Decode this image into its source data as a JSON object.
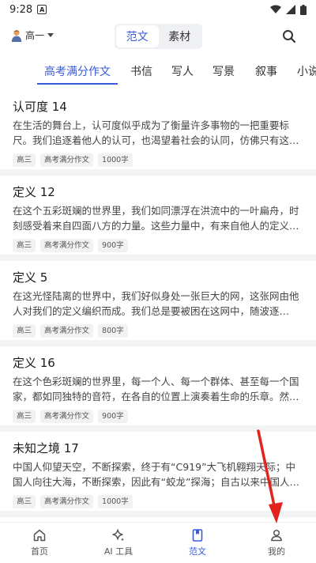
{
  "status_bar": {
    "time": "9:28",
    "app_letter": "A"
  },
  "header": {
    "grade_label": "高一",
    "segments": [
      "范文",
      "素材"
    ],
    "active_segment": 0
  },
  "categories": [
    "高考满分作文",
    "书信",
    "写人",
    "写景",
    "叙事",
    "小说"
  ],
  "active_category": 0,
  "articles": [
    {
      "title": "认可度 14",
      "excerpt": "在生活的舞台上，认可度似乎成为了衡量许多事物的一把重要标尺。我们追逐着他人的认可，也渴望着社会的认同，仿佛只有这…",
      "tags": [
        "高三",
        "高考满分作文",
        "1000字"
      ]
    },
    {
      "title": "定义 12",
      "excerpt": "在这个五彩斑斓的世界里，我们如同漂浮在洪流中的一叶扁舟，时刻感受着来自四面八方的力量。这些力量中，有来自他人的定义…",
      "tags": [
        "高三",
        "高考满分作文",
        "900字"
      ]
    },
    {
      "title": "定义 5",
      "excerpt": "在这光怪陆离的世界中，我们好似身处一张巨大的网，这张网由他人对我们的定义编织而成。我们总是要被困在这网中，随波逐流，…",
      "tags": [
        "高三",
        "高考满分作文",
        "800字"
      ]
    },
    {
      "title": "定义 16",
      "excerpt": "在这个色彩斑斓的世界里，每一个人、每一个群体、甚至每一个国家，都如同独特的音符，在各自的位置上演奏着生命的乐章。然…",
      "tags": [
        "高三",
        "高考满分作文",
        "900字"
      ]
    },
    {
      "title": "未知之境 17",
      "excerpt": "中国人仰望天空，不断探索，终于有“C919”大飞机翱翔天际；中国人向往大海，不断探索，因此有“蛟龙”探海；自古以来中国人…",
      "tags": [
        "高三",
        "高考满分作文",
        "1000字"
      ]
    }
  ],
  "bottom_nav": [
    {
      "label": "首页",
      "icon": "home-icon"
    },
    {
      "label": "AI 工具",
      "icon": "sparkle-icon"
    },
    {
      "label": "范文",
      "icon": "book-icon"
    },
    {
      "label": "我的",
      "icon": "person-icon"
    }
  ],
  "active_nav": 2,
  "colors": {
    "accent": "#3a5ad8",
    "annotation": "#e0231e"
  }
}
